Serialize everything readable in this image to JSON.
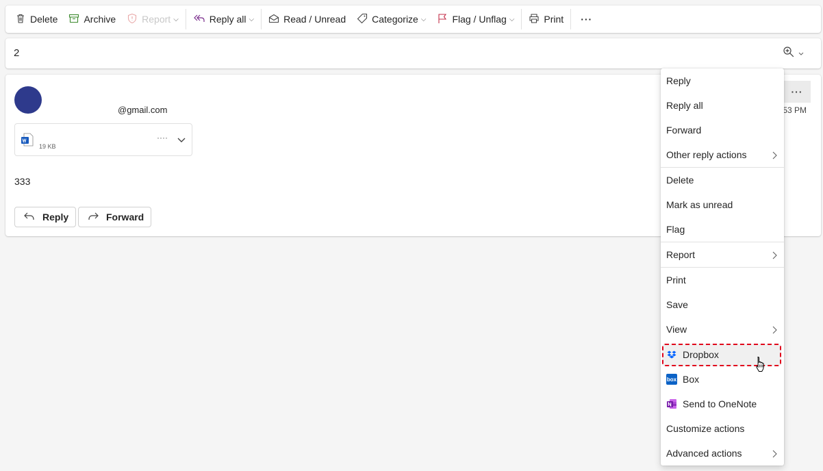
{
  "toolbar": {
    "delete": "Delete",
    "archive": "Archive",
    "report": "Report",
    "reply_all": "Reply all",
    "read_unread": "Read / Unread",
    "categorize": "Categorize",
    "flag_unflag": "Flag / Unflag",
    "print": "Print",
    "more": "···"
  },
  "subject": "2",
  "message": {
    "sender": "@gmail.com",
    "time": "53 PM",
    "more": "···",
    "attachment": {
      "size": "19 KB",
      "more": "····"
    },
    "body": "333",
    "reply_label": "Reply",
    "forward_label": "Forward"
  },
  "menu": {
    "reply": "Reply",
    "reply_all": "Reply all",
    "forward": "Forward",
    "other_reply_actions": "Other reply actions",
    "delete": "Delete",
    "mark_as_unread": "Mark as unread",
    "flag": "Flag",
    "report": "Report",
    "print": "Print",
    "save": "Save",
    "view": "View",
    "dropbox": "Dropbox",
    "box": "Box",
    "box_logo_text": "box",
    "send_to_onenote": "Send to OneNote",
    "customize_actions": "Customize actions",
    "advanced_actions": "Advanced actions"
  },
  "colors": {
    "avatar": "#2e3a8c",
    "highlight_border": "#e0001b",
    "dropbox_blue": "#0061fe",
    "box_blue": "#0b62c6",
    "onenote_purple": "#7719aa",
    "word_blue": "#185abd"
  }
}
